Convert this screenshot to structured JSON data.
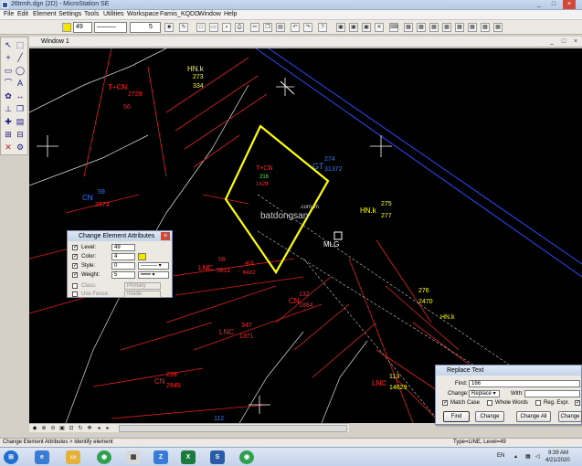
{
  "window": {
    "title": "26trmh.dgn (2D) - MicroStation SE",
    "minimize": "_",
    "maximize": "□",
    "close": "×"
  },
  "menu": [
    "File",
    "Edit",
    "Element",
    "Settings",
    "Tools",
    "Utilities",
    "Workspace",
    "Famis_KQDD",
    "Window",
    "Help"
  ],
  "toolbar": {
    "level_value": "49",
    "weight_value": "5",
    "color_accent": "#f2e400"
  },
  "view": {
    "title": "Window 1"
  },
  "cad_labels": [
    {
      "text": "HN.k",
      "color": "#ffff00",
      "size": 8
    },
    {
      "text": "273",
      "color": "#ffff00",
      "size": 7
    },
    {
      "text": "334",
      "color": "#ffff00",
      "size": 7
    },
    {
      "text": "T+CN",
      "color": "#ff2222",
      "size": 8
    },
    {
      "text": "2729",
      "color": "#ff2222",
      "size": 7
    },
    {
      "text": "56",
      "color": "#ff2222",
      "size": 7
    },
    {
      "text": "GT",
      "color": "#2a7bff",
      "size": 9
    },
    {
      "text": "274",
      "color": "#2a7bff",
      "size": 7
    },
    {
      "text": "31372",
      "color": "#2a7bff",
      "size": 7
    },
    {
      "text": "HN.k",
      "color": "#ffff00",
      "size": 8
    },
    {
      "text": "275",
      "color": "#ffff00",
      "size": 7
    },
    {
      "text": "277",
      "color": "#ffff00",
      "size": 7
    },
    {
      "text": "CN",
      "color": "#2a7bff",
      "size": 8
    },
    {
      "text": "59",
      "color": "#2a7bff",
      "size": 7
    },
    {
      "text": "2973",
      "color": "#ff2222",
      "size": 7
    },
    {
      "text": "T+CN",
      "color": "#ff2222",
      "size": 7
    },
    {
      "text": "216",
      "color": "#2aff2a",
      "size": 6
    },
    {
      "text": "1429",
      "color": "#ff2222",
      "size": 6
    },
    {
      "text": "LNC",
      "color": "#ff2222",
      "size": 8
    },
    {
      "text": "58",
      "color": "#ff2222",
      "size": 7
    },
    {
      "text": "5811",
      "color": "#ff2222",
      "size": 7
    },
    {
      "text": "401",
      "color": "#ff2222",
      "size": 6
    },
    {
      "text": "6482",
      "color": "#ff2222",
      "size": 6
    },
    {
      "text": "MLG",
      "color": "#ffffff",
      "size": 8
    },
    {
      "text": "276",
      "color": "#ffff00",
      "size": 7
    },
    {
      "text": "2470",
      "color": "#ffff00",
      "size": 7
    },
    {
      "text": "HN.k",
      "color": "#ffff00",
      "size": 7
    },
    {
      "text": "CN",
      "color": "#ff2222",
      "size": 8
    },
    {
      "text": "132",
      "color": "#ff2222",
      "size": 7
    },
    {
      "text": "1884",
      "color": "#ff2222",
      "size": 7
    },
    {
      "text": "LNC",
      "color": "#ff2222",
      "size": 8
    },
    {
      "text": "347",
      "color": "#ff2222",
      "size": 7
    },
    {
      "text": "1371",
      "color": "#ff2222",
      "size": 7
    },
    {
      "text": "CN",
      "color": "#ff2222",
      "size": 8
    },
    {
      "text": "228",
      "color": "#ff2222",
      "size": 7
    },
    {
      "text": "2945",
      "color": "#ff2222",
      "size": 7
    },
    {
      "text": "LNC",
      "color": "#ff2222",
      "size": 8
    },
    {
      "text": "113",
      "color": "#ffff00",
      "size": 7
    },
    {
      "text": "14629",
      "color": "#ffff00",
      "size": 7
    },
    {
      "text": "112",
      "color": "#2a7bff",
      "size": 7
    },
    {
      "text": "batdongsan",
      "color": "#cfcfcf",
      "size": 10
    },
    {
      "text": ".com.vn",
      "color": "#cfcfcf",
      "size": 6
    }
  ],
  "change_attrs": {
    "title": "Change Element Attributes",
    "level_label": "Level:",
    "level_value": "49",
    "color_label": "Color:",
    "color_value": "4",
    "style_label": "Style:",
    "style_value": "0",
    "weight_label": "Weight:",
    "weight_value": "5",
    "class_label": "Class:",
    "class_value": "Primary",
    "fence_label": "Use Fence:",
    "fence_value": "Inside"
  },
  "replace_text": {
    "title": "Replace Text",
    "find_label": "Find:",
    "find_value": "166",
    "change_label": "Change:",
    "change_mode": "Replace",
    "with_label": "With:",
    "match_case": "Match Case",
    "whole_words": "Whole Words",
    "reg_expr": "Reg. Expr.",
    "find_btn": "Find",
    "change_btn": "Change",
    "change_all_btn": "Change All",
    "change_partial": "Change"
  },
  "status": {
    "left": "Change Element Attributes > Identify element",
    "right": "Type=LINE, Level=49"
  },
  "taskbar": {
    "lang": "EN",
    "time": "9:39 AM",
    "date": "4/21/2020"
  }
}
